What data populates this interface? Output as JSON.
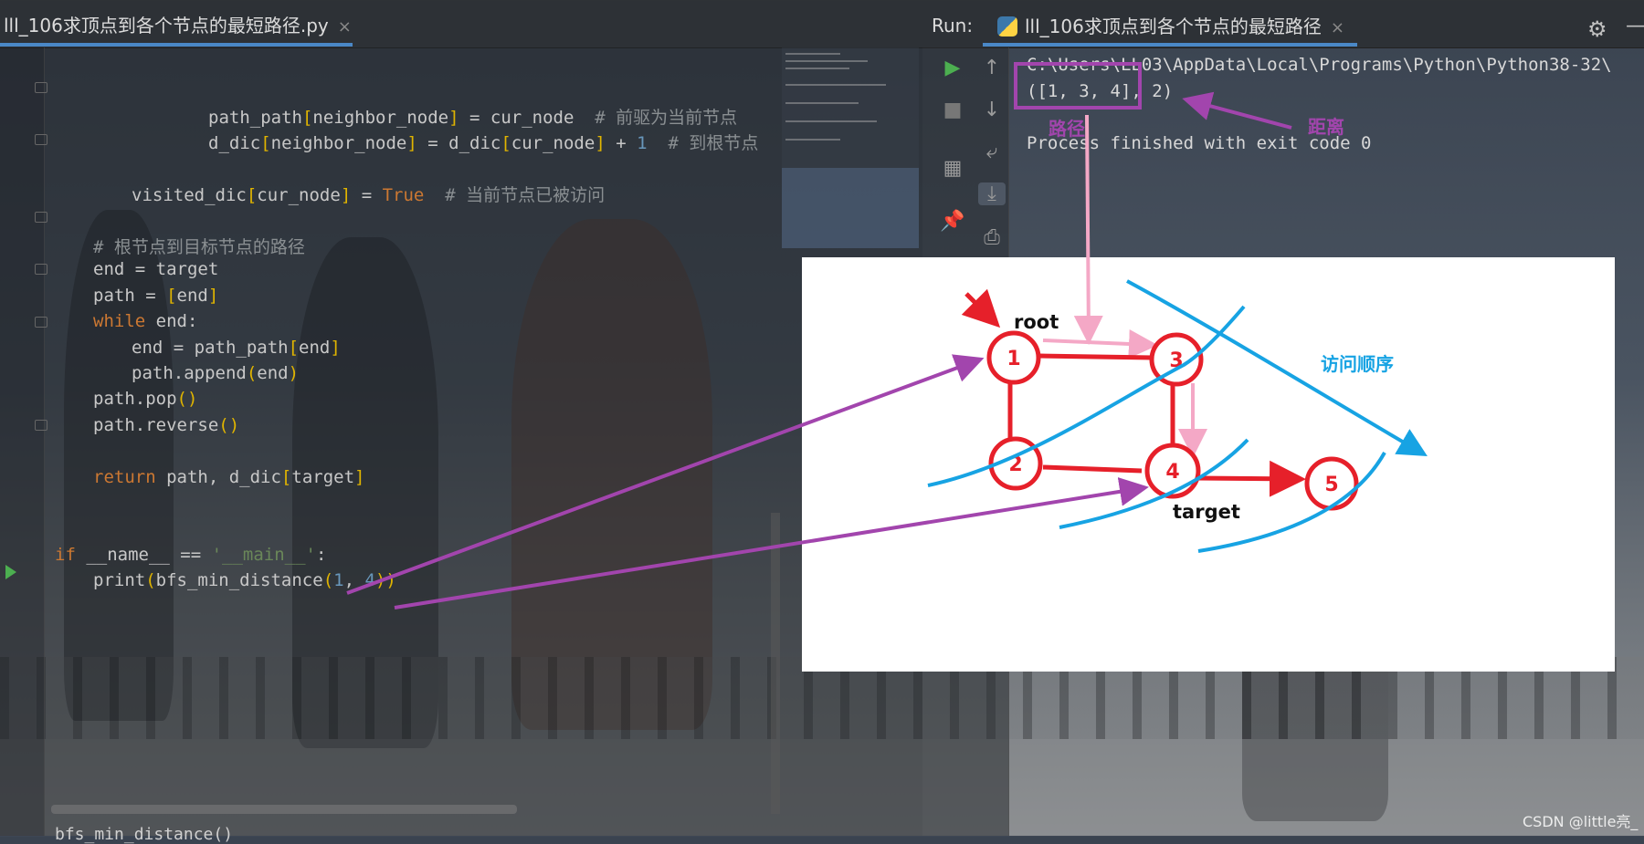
{
  "editor": {
    "tab_title": "lll_106求顶点到各个节点的最短路径.py",
    "tab_close": "×",
    "breadcrumb": "bfs_min_distance()",
    "code": [
      {
        "indent": 4,
        "text": "path_path[neighbor_node] = cur_node  ",
        "comment": "# 前驱为当前节点"
      },
      {
        "indent": 4,
        "text": "d_dic[neighbor_node] = d_dic[cur_node] + 1  ",
        "comment": "# 到根节点"
      },
      {
        "indent": 0,
        "text": "",
        "comment": ""
      },
      {
        "indent": 2,
        "text": "visited_dic[cur_node] = True  ",
        "comment": "# 当前节点已被访问"
      },
      {
        "indent": 0,
        "text": "",
        "comment": ""
      },
      {
        "indent": 1,
        "text": "",
        "comment": "# 根节点到目标节点的路径"
      },
      {
        "indent": 1,
        "text": "end = target",
        "comment": ""
      },
      {
        "indent": 1,
        "text": "path = [end]",
        "comment": ""
      },
      {
        "indent": 1,
        "text": "while end:",
        "comment": ""
      },
      {
        "indent": 2,
        "text": "end = path_path[end]",
        "comment": ""
      },
      {
        "indent": 2,
        "text": "path.append(end)",
        "comment": ""
      },
      {
        "indent": 1,
        "text": "path.pop()",
        "comment": ""
      },
      {
        "indent": 1,
        "text": "path.reverse()",
        "comment": ""
      },
      {
        "indent": 0,
        "text": "",
        "comment": ""
      },
      {
        "indent": 1,
        "text": "return path, d_dic[target]",
        "comment": ""
      },
      {
        "indent": 0,
        "text": "",
        "comment": ""
      },
      {
        "indent": 0,
        "text": "",
        "comment": ""
      },
      {
        "indent": 0,
        "text": "if __name__ == '__main__':",
        "comment": ""
      },
      {
        "indent": 1,
        "text": "print(bfs_min_distance(1, 4))",
        "comment": ""
      }
    ]
  },
  "run": {
    "label": "Run:",
    "tab_title": "lll_106求顶点到各个节点的最短路径",
    "tab_close": "×",
    "console": [
      "C:\\Users\\LL03\\AppData\\Local\\Programs\\Python\\Python38-32\\",
      "([1, 3, 4], 2)",
      "",
      "Process finished with exit code 0"
    ]
  },
  "annotations": {
    "path_label": "路径",
    "distance_label": "距离",
    "visit_order_label": "访问顺序",
    "root_label": "root",
    "target_label": "target",
    "nodes": [
      "1",
      "2",
      "3",
      "4",
      "5"
    ]
  },
  "colors": {
    "red": "#e6202a",
    "pink": "#f4a8c6",
    "purple": "#a245ad",
    "blue": "#17a3e3"
  },
  "watermark": "CSDN @little亮_"
}
